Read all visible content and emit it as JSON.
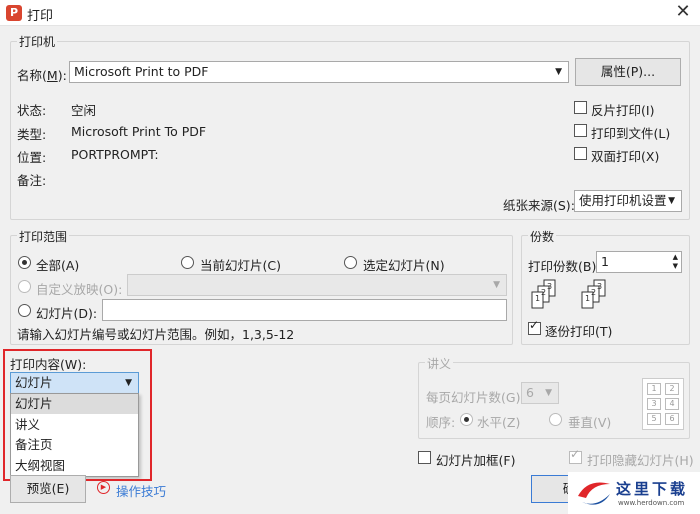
{
  "window": {
    "title": "打印",
    "app_icon_letter": "P"
  },
  "printer": {
    "group_label": "打印机",
    "name_label": "名称(",
    "name_key": "M",
    "name_label_end": "):",
    "name_value": "Microsoft Print to PDF",
    "properties_button": "属性(P)...",
    "status_label": "状态:",
    "status_value": "空闲",
    "type_label": "类型:",
    "type_value": "Microsoft Print To PDF",
    "location_label": "位置:",
    "location_value": "PORTPROMPT:",
    "comment_label": "备注:",
    "reverse_print": "反片打印(I)",
    "print_to_file": "打印到文件(L)",
    "duplex": "双面打印(X)",
    "paper_source_label": "纸张来源(S):",
    "paper_source_value": "使用打印机设置"
  },
  "range": {
    "group_label": "打印范围",
    "all": "全部(A)",
    "current_slide": "当前幻灯片(C)",
    "selected_slides": "选定幻灯片(N)",
    "custom_show": "自定义放映(O):",
    "slides": "幻灯片(D):",
    "slides_value": "",
    "hint": "请输入幻灯片编号或幻灯片范围。例如，1,3,5-12"
  },
  "copies": {
    "group_label": "份数",
    "count_label": "打印份数(B):",
    "count_value": "1",
    "collate": "逐份打印(T)",
    "collate_icon_labels": [
      "1",
      "2",
      "3"
    ]
  },
  "content": {
    "label": "打印内容(W):",
    "selected": "幻灯片",
    "options": [
      "幻灯片",
      "讲义",
      "备注页",
      "大纲视图"
    ]
  },
  "handout": {
    "group_label": "讲义",
    "per_page_label": "每页幻灯片数(G):",
    "per_page_value": "6",
    "order_label": "顺序:",
    "horizontal": "水平(Z)",
    "vertical": "垂直(V)",
    "grid_numbers": [
      "1",
      "2",
      "3",
      "4",
      "5",
      "6"
    ]
  },
  "bottom": {
    "frame_slides": "幻灯片加框(F)",
    "print_hidden": "打印隐藏幻灯片(H)",
    "preview_button": "预览(E)",
    "tips_link": "操作技巧",
    "ok_button": "确"
  },
  "watermark": {
    "text": "这里下载",
    "url": "www.herdown.com"
  },
  "colors": {
    "accent_red": "#e0262a",
    "link_blue": "#3a7bd5",
    "wps_red": "#d9452f"
  }
}
